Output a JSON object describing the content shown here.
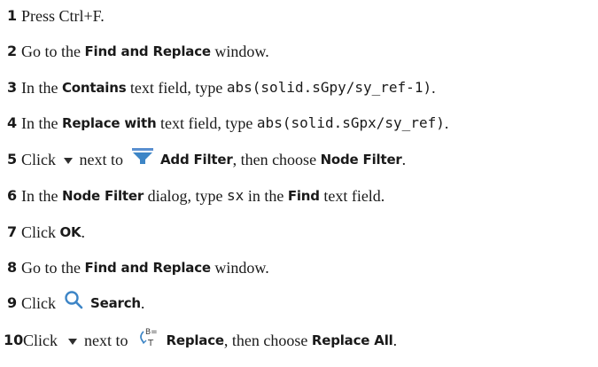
{
  "steps": [
    {
      "num": "1",
      "parts": [
        "Press Ctrl+F."
      ]
    },
    {
      "num": "2",
      "parts": [
        "Go to the ",
        "Find and Replace",
        " window."
      ]
    },
    {
      "num": "3",
      "parts": [
        "In the ",
        "Contains",
        " text field, type ",
        "abs(solid.sGpy/sy_ref-1)",
        "."
      ]
    },
    {
      "num": "4",
      "parts": [
        "In the ",
        "Replace with",
        " text field, type ",
        "abs(solid.sGpx/sy_ref)",
        "."
      ]
    },
    {
      "num": "5",
      "parts": [
        "Click ",
        "next to",
        "Add Filter",
        ", then choose ",
        "Node Filter",
        "."
      ]
    },
    {
      "num": "6",
      "parts": [
        "In the ",
        "Node Filter",
        " dialog, type ",
        "sx",
        " in the ",
        "Find",
        " text field."
      ]
    },
    {
      "num": "7",
      "parts": [
        "Click ",
        "OK",
        "."
      ]
    },
    {
      "num": "8",
      "parts": [
        "Go to the ",
        "Find and Replace",
        " window."
      ]
    },
    {
      "num": "9",
      "parts": [
        "Click",
        "Search",
        "."
      ]
    },
    {
      "num": "10",
      "parts": [
        "Click",
        "next to",
        "Replace",
        ", then choose ",
        "Replace All",
        "."
      ]
    }
  ],
  "icons": {
    "dropdown": "triangle-down-icon",
    "add_filter": "funnel-filter-icon",
    "search": "magnifier-icon",
    "replace": "replace-icon"
  },
  "colors": {
    "text": "#1a1a1a",
    "icon_blue": "#3d85c6",
    "icon_dark": "#2f2f2f"
  }
}
